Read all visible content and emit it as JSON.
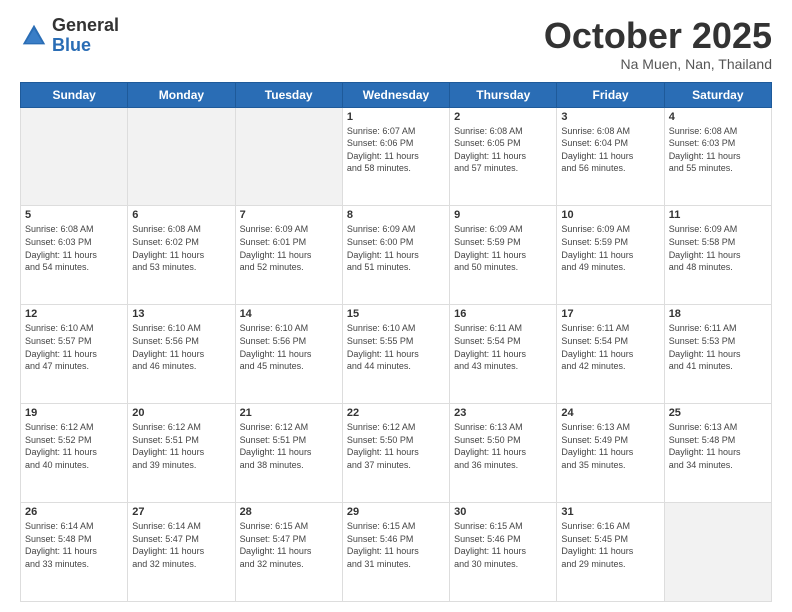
{
  "header": {
    "logo_general": "General",
    "logo_blue": "Blue",
    "title": "October 2025",
    "location": "Na Muen, Nan, Thailand"
  },
  "weekdays": [
    "Sunday",
    "Monday",
    "Tuesday",
    "Wednesday",
    "Thursday",
    "Friday",
    "Saturday"
  ],
  "weeks": [
    [
      {
        "day": "",
        "info": ""
      },
      {
        "day": "",
        "info": ""
      },
      {
        "day": "",
        "info": ""
      },
      {
        "day": "1",
        "info": "Sunrise: 6:07 AM\nSunset: 6:06 PM\nDaylight: 11 hours\nand 58 minutes."
      },
      {
        "day": "2",
        "info": "Sunrise: 6:08 AM\nSunset: 6:05 PM\nDaylight: 11 hours\nand 57 minutes."
      },
      {
        "day": "3",
        "info": "Sunrise: 6:08 AM\nSunset: 6:04 PM\nDaylight: 11 hours\nand 56 minutes."
      },
      {
        "day": "4",
        "info": "Sunrise: 6:08 AM\nSunset: 6:03 PM\nDaylight: 11 hours\nand 55 minutes."
      }
    ],
    [
      {
        "day": "5",
        "info": "Sunrise: 6:08 AM\nSunset: 6:03 PM\nDaylight: 11 hours\nand 54 minutes."
      },
      {
        "day": "6",
        "info": "Sunrise: 6:08 AM\nSunset: 6:02 PM\nDaylight: 11 hours\nand 53 minutes."
      },
      {
        "day": "7",
        "info": "Sunrise: 6:09 AM\nSunset: 6:01 PM\nDaylight: 11 hours\nand 52 minutes."
      },
      {
        "day": "8",
        "info": "Sunrise: 6:09 AM\nSunset: 6:00 PM\nDaylight: 11 hours\nand 51 minutes."
      },
      {
        "day": "9",
        "info": "Sunrise: 6:09 AM\nSunset: 5:59 PM\nDaylight: 11 hours\nand 50 minutes."
      },
      {
        "day": "10",
        "info": "Sunrise: 6:09 AM\nSunset: 5:59 PM\nDaylight: 11 hours\nand 49 minutes."
      },
      {
        "day": "11",
        "info": "Sunrise: 6:09 AM\nSunset: 5:58 PM\nDaylight: 11 hours\nand 48 minutes."
      }
    ],
    [
      {
        "day": "12",
        "info": "Sunrise: 6:10 AM\nSunset: 5:57 PM\nDaylight: 11 hours\nand 47 minutes."
      },
      {
        "day": "13",
        "info": "Sunrise: 6:10 AM\nSunset: 5:56 PM\nDaylight: 11 hours\nand 46 minutes."
      },
      {
        "day": "14",
        "info": "Sunrise: 6:10 AM\nSunset: 5:56 PM\nDaylight: 11 hours\nand 45 minutes."
      },
      {
        "day": "15",
        "info": "Sunrise: 6:10 AM\nSunset: 5:55 PM\nDaylight: 11 hours\nand 44 minutes."
      },
      {
        "day": "16",
        "info": "Sunrise: 6:11 AM\nSunset: 5:54 PM\nDaylight: 11 hours\nand 43 minutes."
      },
      {
        "day": "17",
        "info": "Sunrise: 6:11 AM\nSunset: 5:54 PM\nDaylight: 11 hours\nand 42 minutes."
      },
      {
        "day": "18",
        "info": "Sunrise: 6:11 AM\nSunset: 5:53 PM\nDaylight: 11 hours\nand 41 minutes."
      }
    ],
    [
      {
        "day": "19",
        "info": "Sunrise: 6:12 AM\nSunset: 5:52 PM\nDaylight: 11 hours\nand 40 minutes."
      },
      {
        "day": "20",
        "info": "Sunrise: 6:12 AM\nSunset: 5:51 PM\nDaylight: 11 hours\nand 39 minutes."
      },
      {
        "day": "21",
        "info": "Sunrise: 6:12 AM\nSunset: 5:51 PM\nDaylight: 11 hours\nand 38 minutes."
      },
      {
        "day": "22",
        "info": "Sunrise: 6:12 AM\nSunset: 5:50 PM\nDaylight: 11 hours\nand 37 minutes."
      },
      {
        "day": "23",
        "info": "Sunrise: 6:13 AM\nSunset: 5:50 PM\nDaylight: 11 hours\nand 36 minutes."
      },
      {
        "day": "24",
        "info": "Sunrise: 6:13 AM\nSunset: 5:49 PM\nDaylight: 11 hours\nand 35 minutes."
      },
      {
        "day": "25",
        "info": "Sunrise: 6:13 AM\nSunset: 5:48 PM\nDaylight: 11 hours\nand 34 minutes."
      }
    ],
    [
      {
        "day": "26",
        "info": "Sunrise: 6:14 AM\nSunset: 5:48 PM\nDaylight: 11 hours\nand 33 minutes."
      },
      {
        "day": "27",
        "info": "Sunrise: 6:14 AM\nSunset: 5:47 PM\nDaylight: 11 hours\nand 32 minutes."
      },
      {
        "day": "28",
        "info": "Sunrise: 6:15 AM\nSunset: 5:47 PM\nDaylight: 11 hours\nand 32 minutes."
      },
      {
        "day": "29",
        "info": "Sunrise: 6:15 AM\nSunset: 5:46 PM\nDaylight: 11 hours\nand 31 minutes."
      },
      {
        "day": "30",
        "info": "Sunrise: 6:15 AM\nSunset: 5:46 PM\nDaylight: 11 hours\nand 30 minutes."
      },
      {
        "day": "31",
        "info": "Sunrise: 6:16 AM\nSunset: 5:45 PM\nDaylight: 11 hours\nand 29 minutes."
      },
      {
        "day": "",
        "info": ""
      }
    ]
  ]
}
